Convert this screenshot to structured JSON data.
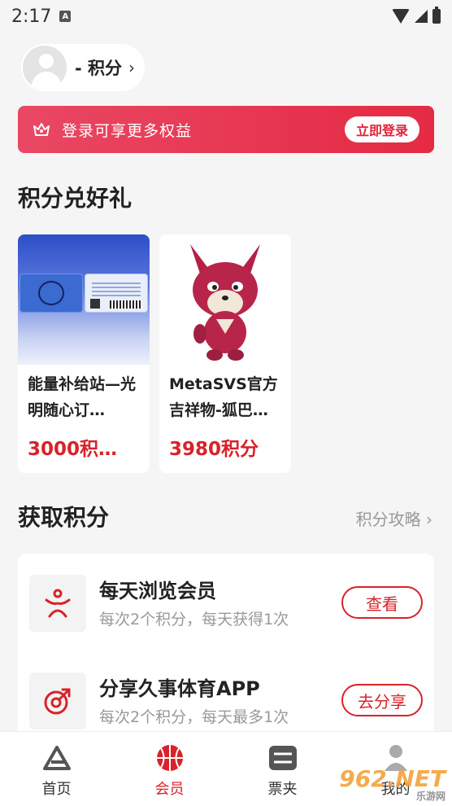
{
  "status_bar": {
    "time": "2:17",
    "badge": "A"
  },
  "profile": {
    "name": "- 积分",
    "chevron": "›"
  },
  "login_banner": {
    "text": "登录可享更多权益",
    "button": "立即登录",
    "icon": "crown-icon"
  },
  "gifts_section": {
    "title": "积分兑好礼",
    "items": [
      {
        "name": "能量补给站—光明随心订…",
        "price": "3000积…"
      },
      {
        "name": "MetaSVS官方吉祥物-狐巴…",
        "price": "3980积分"
      }
    ]
  },
  "earn_section": {
    "title": "获取积分",
    "guide_link": "积分攻略 ›",
    "tasks": [
      {
        "title": "每天浏览会员",
        "desc": "每次2个积分，每天获得1次",
        "button": "查看",
        "icon": "member-icon"
      },
      {
        "title": "分享久事体育APP",
        "desc": "每次2个积分，每天最多1次",
        "button": "去分享",
        "icon": "share-icon"
      }
    ]
  },
  "bottom_nav": {
    "items": [
      {
        "label": "首页",
        "icon": "home-logo-icon"
      },
      {
        "label": "会员",
        "icon": "basketball-icon",
        "active": true
      },
      {
        "label": "票夹",
        "icon": "ticket-icon"
      },
      {
        "label": "我的",
        "icon": "user-icon"
      }
    ]
  },
  "watermark": {
    "text": "962.NET",
    "sub": "乐游网"
  },
  "colors": {
    "accent": "#d9222a",
    "banner": "#e52a44"
  }
}
